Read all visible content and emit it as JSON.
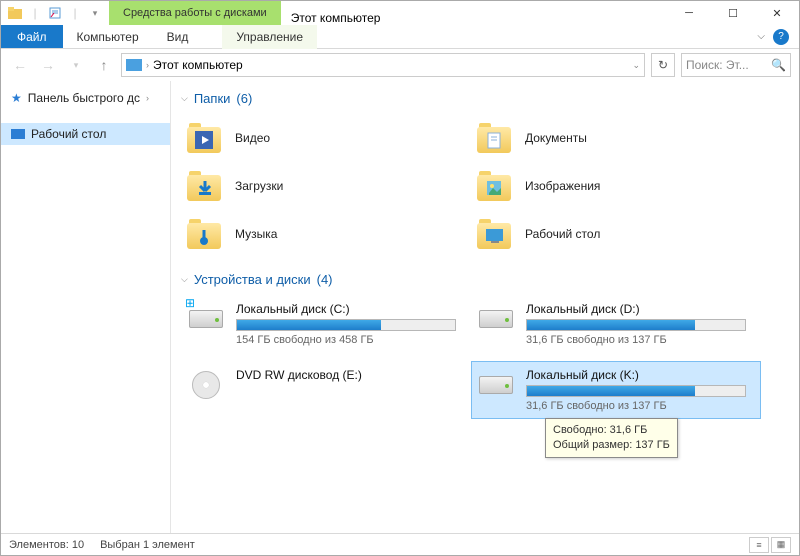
{
  "title": "Этот компьютер",
  "ribbon_context_label": "Средства работы с дисками",
  "ribbon": {
    "file": "Файл",
    "tabs": [
      "Компьютер",
      "Вид"
    ],
    "context_tab": "Управление"
  },
  "address": {
    "text": "Этот компьютер"
  },
  "search": {
    "placeholder": "Поиск: Эт..."
  },
  "nav": {
    "quick": "Панель быстрого дс",
    "desktop": "Рабочий стол"
  },
  "groups": {
    "folders": {
      "label": "Папки",
      "count": "(6)"
    },
    "drives": {
      "label": "Устройства и диски",
      "count": "(4)"
    }
  },
  "folders": [
    {
      "label": "Видео"
    },
    {
      "label": "Документы"
    },
    {
      "label": "Загрузки"
    },
    {
      "label": "Изображения"
    },
    {
      "label": "Музыка"
    },
    {
      "label": "Рабочий стол"
    }
  ],
  "drives": [
    {
      "name": "Локальный диск (C:)",
      "free_text": "154 ГБ свободно из 458 ГБ",
      "fill_pct": 66,
      "type": "hdd",
      "win": true
    },
    {
      "name": "Локальный диск (D:)",
      "free_text": "31,6 ГБ свободно из 137 ГБ",
      "fill_pct": 77,
      "type": "hdd"
    },
    {
      "name": "DVD RW дисковод (E:)",
      "type": "dvd"
    },
    {
      "name": "Локальный диск (K:)",
      "free_text": "31,6 ГБ свободно из 137 ГБ",
      "fill_pct": 77,
      "type": "hdd",
      "selected": true
    }
  ],
  "tooltip": {
    "line1": "Свободно: 31,6 ГБ",
    "line2": "Общий размер: 137 ГБ"
  },
  "status": {
    "count": "Элементов: 10",
    "selected": "Выбран 1 элемент"
  }
}
